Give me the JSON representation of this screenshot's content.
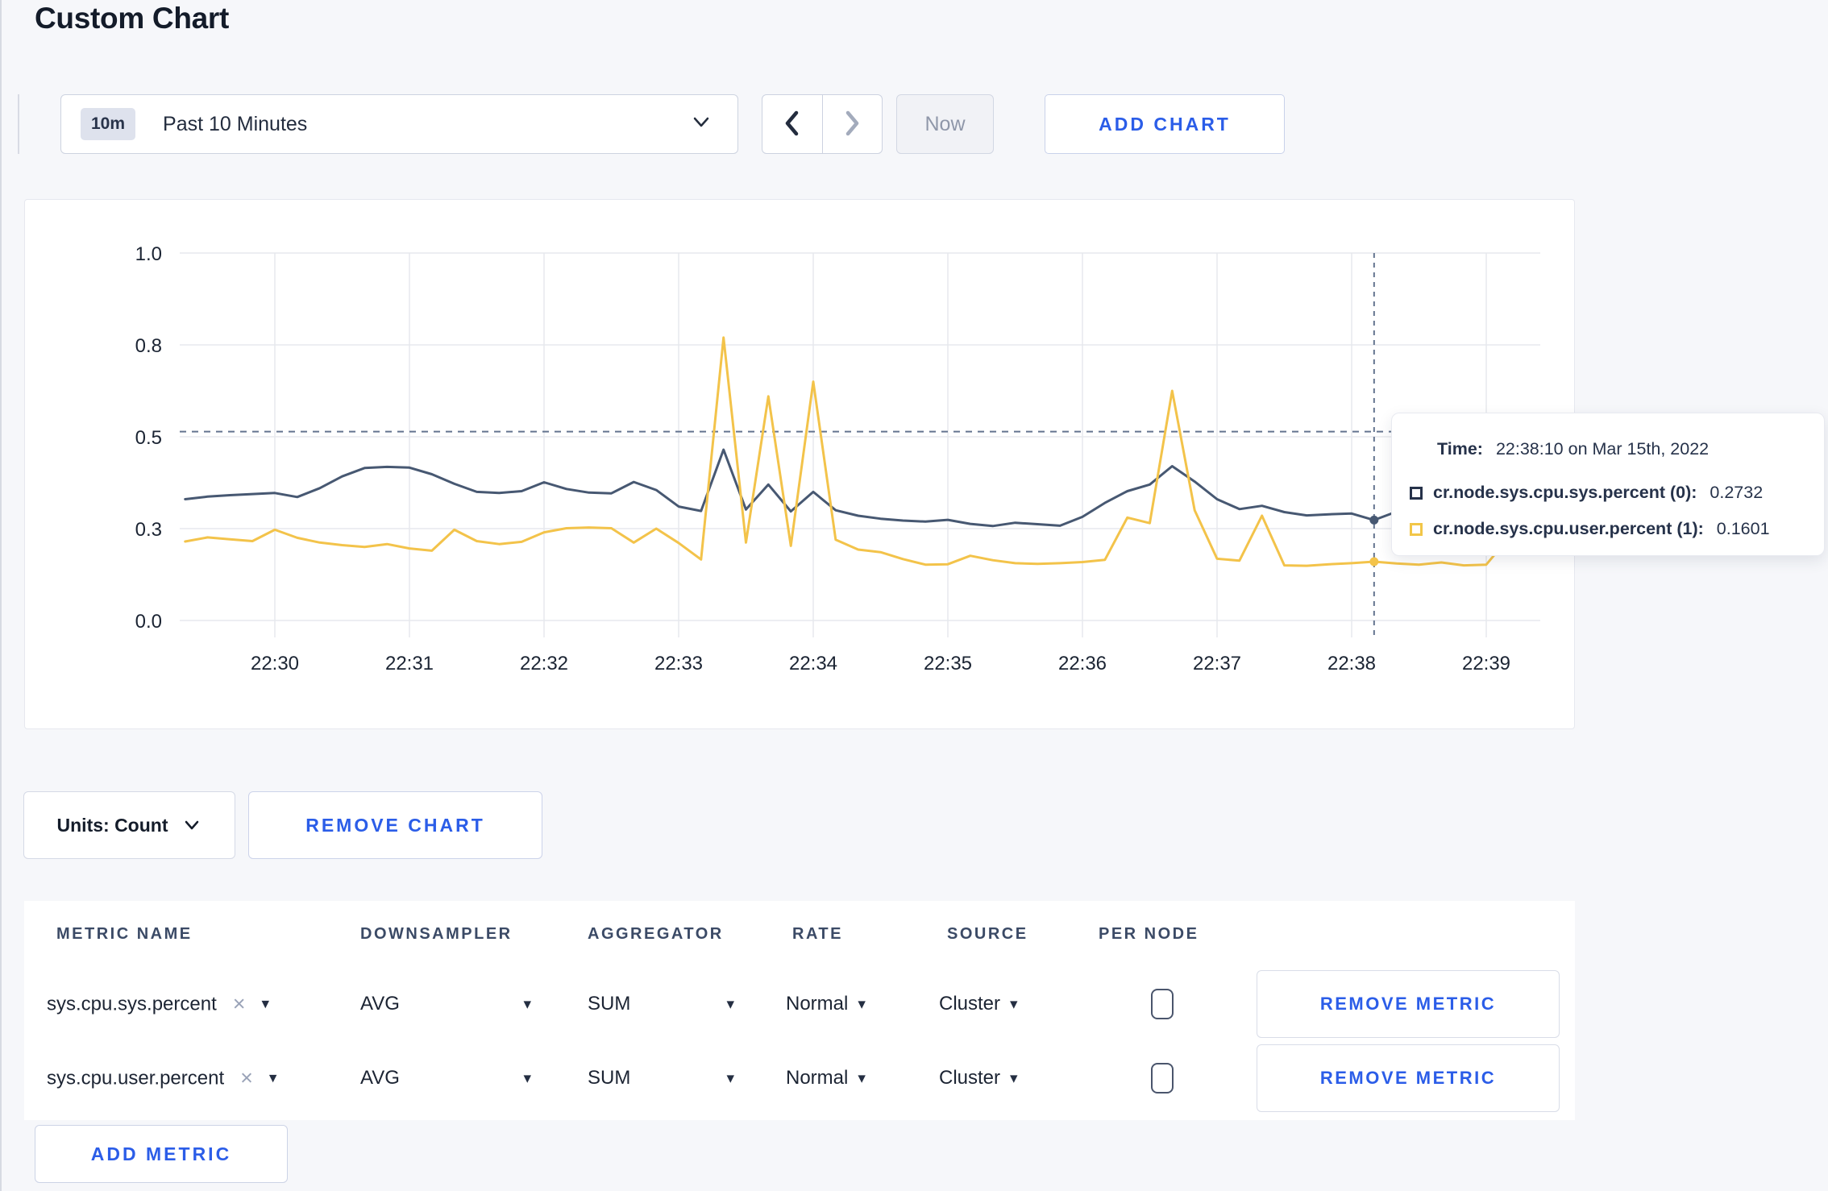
{
  "page": {
    "title": "Custom Chart"
  },
  "toolbar": {
    "time_range": {
      "badge": "10m",
      "label": "Past 10 Minutes"
    },
    "now_label": "Now",
    "add_chart_label": "ADD CHART"
  },
  "icons": {
    "dropdown_caret": "▾",
    "close": "×"
  },
  "colors": {
    "accent_blue": "#2b5de8",
    "series_sys": "#475872",
    "series_user": "#f3c34a",
    "tooltip_sys_swatch": "#26324a",
    "tooltip_user_swatch": "#f2c648",
    "guide_dash": "#64748f",
    "grid": "#e7e9ed"
  },
  "chart_data": {
    "type": "line",
    "title": "",
    "xlabel": "",
    "ylabel": "",
    "ylim": [
      0,
      1
    ],
    "grid": true,
    "legend_position": "none",
    "y_axis": {
      "ticks": [
        {
          "v": 0,
          "label": "0.0"
        },
        {
          "v": 0.25,
          "label": "0.3"
        },
        {
          "v": 0.5,
          "label": "0.5"
        },
        {
          "v": 0.75,
          "label": "0.8"
        },
        {
          "v": 1,
          "label": "1.0"
        }
      ]
    },
    "x_axis": {
      "tick_labels": [
        "22:30",
        "22:31",
        "22:32",
        "22:33",
        "22:34",
        "22:35",
        "22:36",
        "22:37",
        "22:38",
        "22:39"
      ],
      "start_offset_seconds": -40,
      "step_seconds": 10
    },
    "guide_line_y": 0.514,
    "crosshair": {
      "seconds_from_2230": 490,
      "time": "22:38:10",
      "values": [
        0.2732,
        0.1601
      ]
    },
    "series": [
      {
        "name": "cr.node.sys.cpu.sys.percent (0)",
        "color": "#475872",
        "values": [
          0.33,
          0.337,
          0.341,
          0.344,
          0.347,
          0.336,
          0.36,
          0.392,
          0.415,
          0.418,
          0.416,
          0.398,
          0.372,
          0.35,
          0.347,
          0.352,
          0.376,
          0.358,
          0.348,
          0.346,
          0.377,
          0.355,
          0.31,
          0.298,
          0.465,
          0.302,
          0.37,
          0.297,
          0.35,
          0.3,
          0.285,
          0.277,
          0.272,
          0.269,
          0.274,
          0.263,
          0.257,
          0.266,
          0.262,
          0.258,
          0.282,
          0.32,
          0.352,
          0.37,
          0.42,
          0.378,
          0.33,
          0.303,
          0.312,
          0.295,
          0.286,
          0.289,
          0.291,
          0.2732,
          0.296,
          0.312,
          0.297,
          0.3,
          0.303,
          0.3,
          0.297
        ]
      },
      {
        "name": "cr.node.sys.cpu.user.percent (1)",
        "color": "#f3c34a",
        "values": [
          0.215,
          0.226,
          0.221,
          0.216,
          0.247,
          0.225,
          0.212,
          0.205,
          0.2,
          0.208,
          0.196,
          0.19,
          0.247,
          0.216,
          0.208,
          0.214,
          0.24,
          0.251,
          0.253,
          0.251,
          0.212,
          0.25,
          0.211,
          0.166,
          0.77,
          0.212,
          0.61,
          0.203,
          0.65,
          0.22,
          0.193,
          0.186,
          0.167,
          0.152,
          0.153,
          0.176,
          0.164,
          0.156,
          0.154,
          0.156,
          0.159,
          0.165,
          0.28,
          0.265,
          0.625,
          0.3,
          0.168,
          0.163,
          0.285,
          0.15,
          0.149,
          0.153,
          0.156,
          0.1601,
          0.155,
          0.152,
          0.158,
          0.15,
          0.152,
          0.225,
          0.27
        ]
      }
    ]
  },
  "tooltip": {
    "time_label": "Time:",
    "time_value": "22:38:10 on Mar 15th, 2022",
    "entries": [
      {
        "name": "cr.node.sys.cpu.sys.percent (0):",
        "value": "0.2732",
        "color": "#26324a"
      },
      {
        "name": "cr.node.sys.cpu.user.percent (1):",
        "value": "0.1601",
        "color": "#f2c648"
      }
    ]
  },
  "chart_controls": {
    "units_label": "Units: Count",
    "remove_chart_label": "REMOVE CHART"
  },
  "table": {
    "headers": [
      "METRIC NAME",
      "DOWNSAMPLER",
      "AGGREGATOR",
      "RATE",
      "SOURCE",
      "PER NODE"
    ],
    "rows": [
      {
        "metric_name": "sys.cpu.sys.percent",
        "downsampler": "AVG",
        "aggregator": "SUM",
        "rate": "Normal",
        "source": "Cluster",
        "per_node_checked": false,
        "remove_label": "REMOVE METRIC"
      },
      {
        "metric_name": "sys.cpu.user.percent",
        "downsampler": "AVG",
        "aggregator": "SUM",
        "rate": "Normal",
        "source": "Cluster",
        "per_node_checked": false,
        "remove_label": "REMOVE METRIC"
      }
    ],
    "add_metric_label": "ADD METRIC"
  }
}
